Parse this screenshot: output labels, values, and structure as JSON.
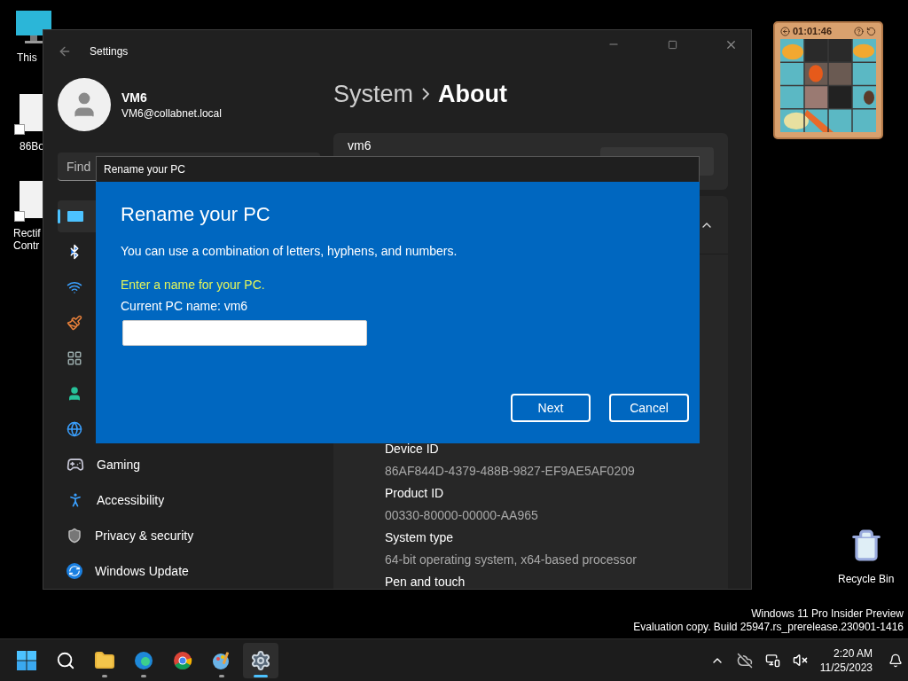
{
  "desktop": {
    "icons": [
      {
        "lines": [
          "This"
        ]
      },
      {
        "lines": [
          "86Bo"
        ]
      },
      {
        "lines": [
          "Rectif",
          "Contr"
        ]
      }
    ],
    "recycle_bin": {
      "label": "Recycle Bin"
    },
    "notice": [
      "Windows 11 Pro Insider Preview",
      "Evaluation copy. Build 25947.rs_prerelease.230901-1416"
    ]
  },
  "settings": {
    "title": "Settings",
    "user": {
      "name": "VM6",
      "email": "VM6@collabnet.local"
    },
    "search": {
      "placeholder": "Find"
    },
    "nav": [
      {
        "selected": true
      },
      {
        "selected": false
      },
      {
        "selected": false
      },
      {
        "selected": false
      },
      {
        "selected": false
      },
      {
        "selected": false
      },
      {
        "selected": false
      },
      {
        "label": "Gaming",
        "selected": false
      },
      {
        "label": "Accessibility",
        "selected": false
      },
      {
        "label": "Privacy & security",
        "selected": false
      },
      {
        "label": "Windows Update",
        "selected": false
      }
    ],
    "breadcrumb": [
      "System",
      "About"
    ],
    "device_name": "vm6",
    "specs": [
      {
        "label": "Device ID",
        "value": "86AF844D-4379-488B-9827-EF9AE5AF0209"
      },
      {
        "label": "Product ID",
        "value": "00330-80000-00000-AA965"
      },
      {
        "label": "System type",
        "value": "64-bit operating system, x64-based processor"
      },
      {
        "label": "Pen and touch"
      }
    ]
  },
  "dialog": {
    "title": "Rename your PC",
    "heading": "Rename your PC",
    "description": "You can use a combination of letters, hyphens, and numbers.",
    "prompt": "Enter a name for your PC.",
    "current_name": "Current PC name: vm6",
    "buttons": [
      "Next",
      "Cancel"
    ]
  },
  "puzzle": {
    "timer": "01:01:46"
  },
  "taskbar": {
    "apps": [
      {
        "running": true,
        "active": false
      },
      {
        "running": true,
        "active": false
      },
      {
        "running": false,
        "active": false
      },
      {
        "running": true,
        "active": false
      },
      {
        "running": true,
        "active": true
      }
    ],
    "time": "2:20 AM",
    "date": "11/25/2023"
  }
}
